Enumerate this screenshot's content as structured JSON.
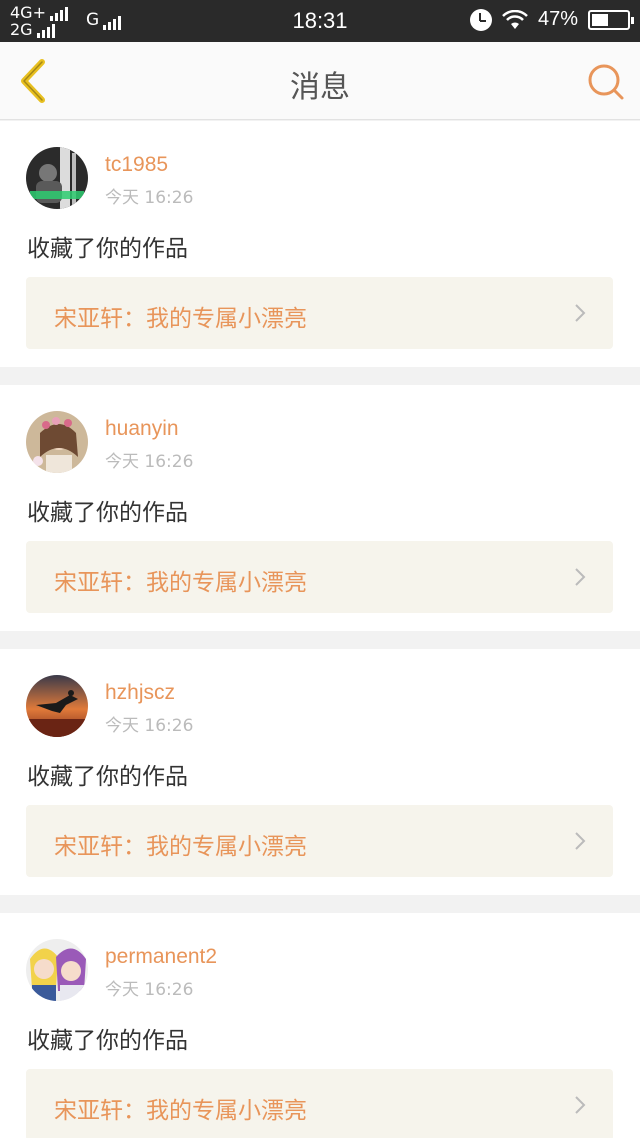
{
  "status_bar": {
    "network_top": "4G+",
    "network_bottom": "2G",
    "network_g": "G",
    "time": "18:31",
    "battery": "47%",
    "battery_level": 0.47,
    "icons": [
      "signal-icon",
      "alarm-icon",
      "wifi-icon",
      "battery-icon"
    ]
  },
  "header": {
    "title": "消息",
    "back_icon": "chevron-left-icon",
    "search_icon": "search-icon"
  },
  "colors": {
    "accent": "#e8955a",
    "back_icon": "#e8c020",
    "link_bg": "#f6f4ec"
  },
  "messages": [
    {
      "username": "tc1985",
      "time": "今天 16:26",
      "action": "收藏了你的作品",
      "work": "宋亚轩：我的专属小漂亮"
    },
    {
      "username": "huanyin",
      "time": "今天 16:26",
      "action": "收藏了你的作品",
      "work": "宋亚轩：我的专属小漂亮"
    },
    {
      "username": "hzhjscz",
      "time": "今天 16:26",
      "action": "收藏了你的作品",
      "work": "宋亚轩：我的专属小漂亮"
    },
    {
      "username": "permanent2",
      "time": "今天 16:26",
      "action": "收藏了你的作品",
      "work": "宋亚轩：我的专属小漂亮"
    }
  ]
}
